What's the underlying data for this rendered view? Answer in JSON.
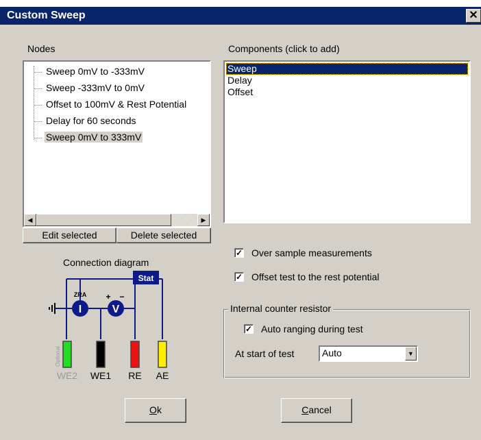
{
  "window": {
    "title": "Custom Sweep",
    "close_glyph": "✕"
  },
  "nodes": {
    "label": "Nodes",
    "items": [
      "Sweep 0mV to -333mV",
      "Sweep -333mV to 0mV",
      "Offset to 100mV & Rest Potential",
      "Delay for 60 seconds",
      "Sweep 0mV to 333mV"
    ],
    "selected_index": 4,
    "edit_button": "Edit selected",
    "delete_button": "Delete selected"
  },
  "components": {
    "label": "Components (click to add)",
    "items": [
      "Sweep",
      "Delay",
      "Offset"
    ],
    "selected_index": 0
  },
  "options": {
    "over_sample": {
      "label": "Over sample measurements",
      "checked": true
    },
    "offset_rest": {
      "label": "Offset test to the rest potential",
      "checked": true
    }
  },
  "counter_resistor": {
    "title": "Internal counter resistor",
    "auto_ranging": {
      "label": "Auto ranging during test",
      "checked": true
    },
    "start_label": "At start of test",
    "start_value": "Auto"
  },
  "diagram": {
    "title": "Connection diagram",
    "stat_label": "Stat",
    "zra_label": "ZRA",
    "current_symbol": "I",
    "voltage_symbol": "V",
    "plus": "+",
    "minus": "−",
    "optional_label": "Optional",
    "electrodes": [
      {
        "label": "WE2",
        "color": "#22dd22",
        "optional": true
      },
      {
        "label": "WE1",
        "color": "#000000",
        "optional": false
      },
      {
        "label": "RE",
        "color": "#ee1111",
        "optional": false
      },
      {
        "label": "AE",
        "color": "#ffee00",
        "optional": false
      }
    ]
  },
  "footer": {
    "ok_accel": "O",
    "ok_rest": "k",
    "cancel_accel": "C",
    "cancel_rest": "ancel"
  },
  "colors": {
    "titlebar": "#0a246a",
    "face": "#d4d0c8",
    "selection": "#0a246a",
    "diagram_blue": "#0c1a8a"
  }
}
